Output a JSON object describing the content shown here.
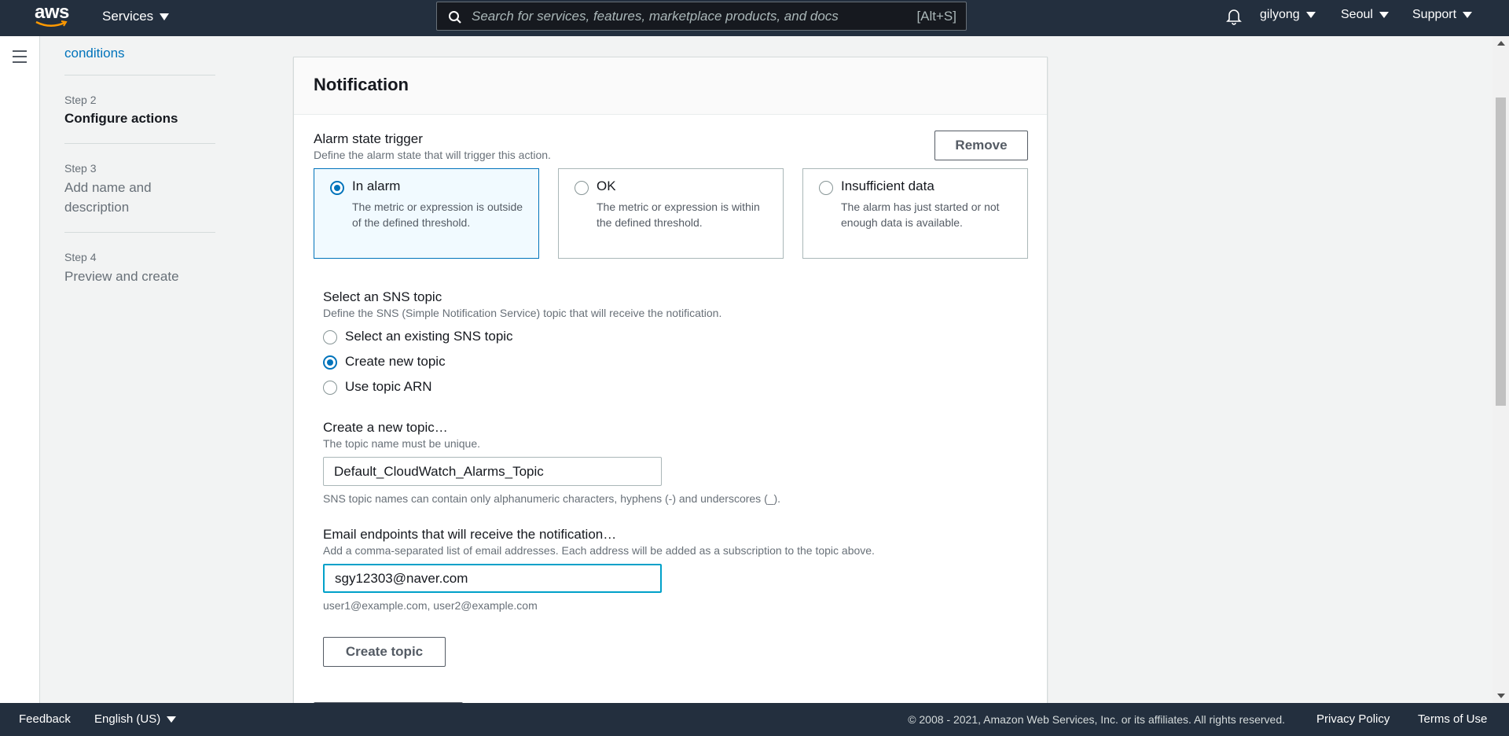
{
  "topnav": {
    "logo_text": "aws",
    "services_label": "Services",
    "search": {
      "placeholder": "Search for services, features, marketplace products, and docs",
      "shortcut": "[Alt+S]"
    },
    "user": "gilyong",
    "region": "Seoul",
    "support": "Support"
  },
  "steps": {
    "partial_link": "conditions",
    "step2": {
      "num": "Step 2",
      "title": "Configure actions"
    },
    "step3": {
      "num": "Step 3",
      "title_line1": "Add name and",
      "title_line2": "description"
    },
    "step4": {
      "num": "Step 4",
      "title": "Preview and create"
    }
  },
  "panel": {
    "title": "Notification",
    "alarm_trigger": {
      "label": "Alarm state trigger",
      "description": "Define the alarm state that will trigger this action.",
      "remove_label": "Remove",
      "options": [
        {
          "title": "In alarm",
          "description": "The metric or expression is outside of the defined threshold.",
          "selected": true
        },
        {
          "title": "OK",
          "description": "The metric or expression is within the defined threshold.",
          "selected": false
        },
        {
          "title": "Insufficient data",
          "description": "The alarm has just started or not enough data is available.",
          "selected": false
        }
      ]
    },
    "sns": {
      "label": "Select an SNS topic",
      "description": "Define the SNS (Simple Notification Service) topic that will receive the notification.",
      "options": [
        {
          "label": "Select an existing SNS topic",
          "selected": false
        },
        {
          "label": "Create new topic",
          "selected": true
        },
        {
          "label": "Use topic ARN",
          "selected": false
        }
      ]
    },
    "new_topic": {
      "label": "Create a new topic…",
      "description": "The topic name must be unique.",
      "value": "Default_CloudWatch_Alarms_Topic",
      "constraint": "SNS topic names can contain only alphanumeric characters, hyphens (-) and underscores (_)."
    },
    "email": {
      "label": "Email endpoints that will receive the notification…",
      "description": "Add a comma-separated list of email addresses. Each address will be added as a subscription to the topic above.",
      "value": "sgy12303@naver.com",
      "hint": "user1@example.com, user2@example.com"
    },
    "create_topic_label": "Create topic"
  },
  "footer": {
    "feedback": "Feedback",
    "language": "English (US)",
    "copyright": "© 2008 - 2021, Amazon Web Services, Inc. or its affiliates. All rights reserved.",
    "privacy": "Privacy Policy",
    "terms": "Terms of Use"
  },
  "colors": {
    "nav_bg": "#232f3e",
    "accent": "#0073bb",
    "focus": "#00a1c9",
    "selected_bg": "#f1faff"
  }
}
